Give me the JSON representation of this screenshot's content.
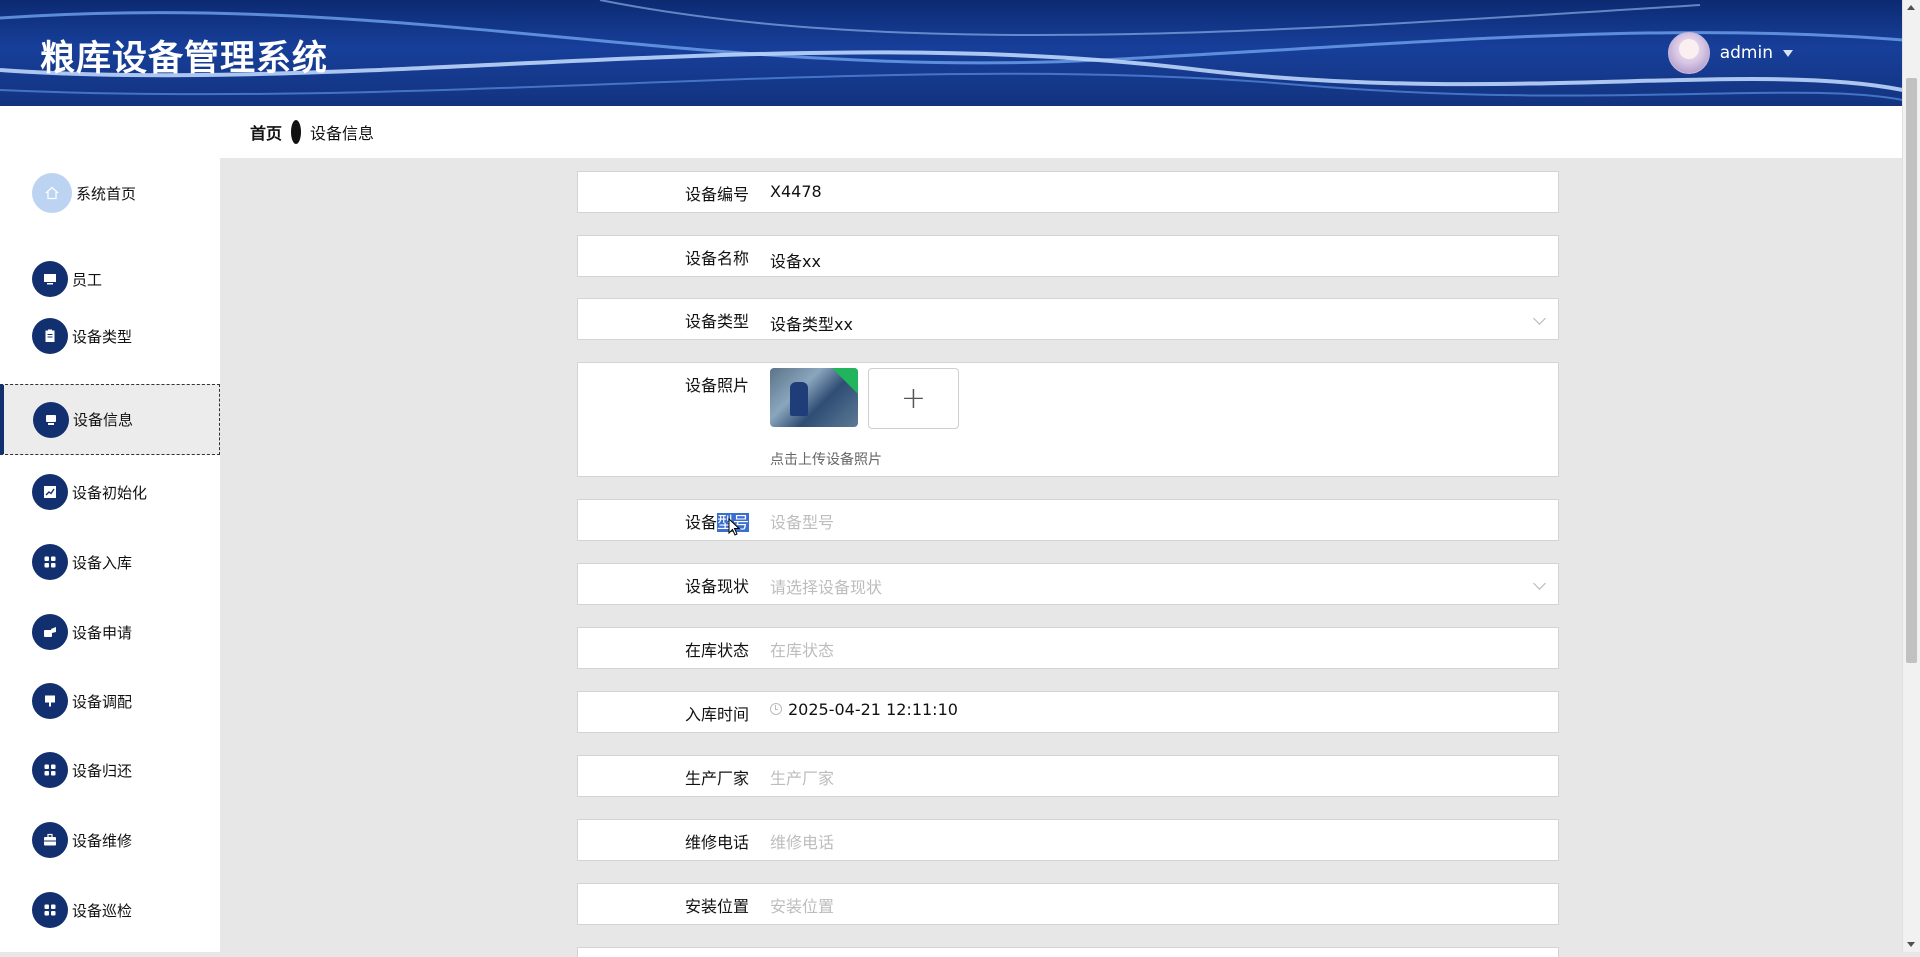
{
  "app": {
    "title": "粮库设备管理系统"
  },
  "user": {
    "name": "admin"
  },
  "breadcrumb": {
    "home": "首页",
    "current": "设备信息"
  },
  "sidebar": {
    "items": [
      {
        "label": "系统首页",
        "icon": "home-icon"
      },
      {
        "label": "员工",
        "icon": "monitor-icon"
      },
      {
        "label": "设备类型",
        "icon": "clipboard-icon"
      },
      {
        "label": "设备信息",
        "icon": "device-icon",
        "active": true
      },
      {
        "label": "设备初始化",
        "icon": "chart-icon"
      },
      {
        "label": "设备入库",
        "icon": "grid-icon"
      },
      {
        "label": "设备申请",
        "icon": "hand-icon"
      },
      {
        "label": "设备调配",
        "icon": "stamp-icon"
      },
      {
        "label": "设备归还",
        "icon": "grid-icon"
      },
      {
        "label": "设备维修",
        "icon": "briefcase-icon"
      },
      {
        "label": "设备巡检",
        "icon": "grid-icon"
      }
    ]
  },
  "form": {
    "code": {
      "label": "设备编号",
      "value": "X4478"
    },
    "name": {
      "label": "设备名称",
      "value": "设备xx"
    },
    "type": {
      "label": "设备类型",
      "value": "设备类型xx"
    },
    "photo": {
      "label": "设备照片",
      "tip": "点击上传设备照片"
    },
    "model": {
      "label_pre": "设备",
      "label_hl": "型号",
      "placeholder": "设备型号"
    },
    "status": {
      "label": "设备现状",
      "placeholder": "请选择设备现状"
    },
    "stock": {
      "label": "在库状态",
      "placeholder": "在库状态"
    },
    "time": {
      "label": "入库时间",
      "value": "2025-04-21 12:11:10"
    },
    "maker": {
      "label": "生产厂家",
      "placeholder": "生产厂家"
    },
    "phone": {
      "label": "维修电话",
      "placeholder": "维修电话"
    },
    "location": {
      "label": "安装位置",
      "placeholder": "安装位置"
    }
  },
  "colors": {
    "header": "#12337f",
    "nav_icon": "#12306f",
    "highlight": "#3a6fd0"
  }
}
